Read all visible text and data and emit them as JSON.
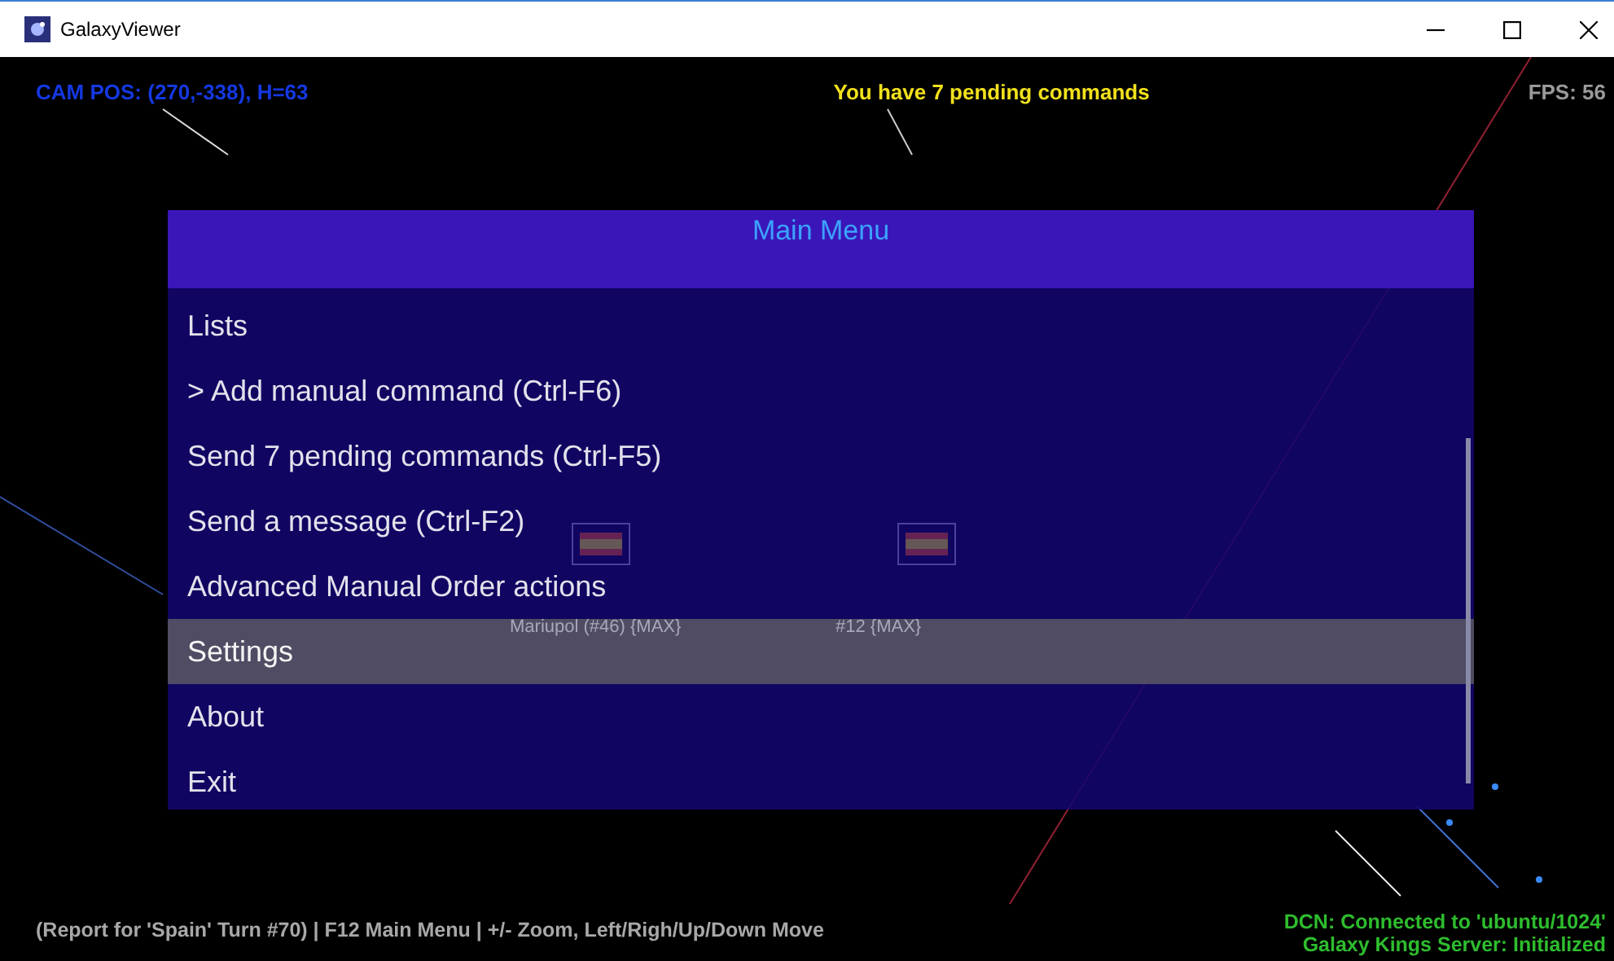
{
  "window": {
    "title": "GalaxyViewer"
  },
  "hud": {
    "camera": "CAM POS: (270,-338), H=63",
    "pending": "You have 7 pending commands",
    "fps": "FPS: 56"
  },
  "planets": [
    {
      "label": "Mariupol (#46) {MAX}"
    },
    {
      "label": "#12 {MAX}"
    }
  ],
  "menu": {
    "title": "Main Menu",
    "items": [
      {
        "label": "Lists",
        "selected": false
      },
      {
        "label": "> Add manual command (Ctrl-F6)",
        "selected": false
      },
      {
        "label": "Send 7 pending commands (Ctrl-F5)",
        "selected": false
      },
      {
        "label": "Send a message (Ctrl-F2)",
        "selected": false
      },
      {
        "label": "Advanced Manual Order actions",
        "selected": false
      },
      {
        "label": "Settings",
        "selected": true
      },
      {
        "label": "About",
        "selected": false
      },
      {
        "label": "Exit",
        "selected": false
      }
    ]
  },
  "status_bar": {
    "help": "(Report for 'Spain' Turn #70) | F12 Main Menu | +/- Zoom, Left/Righ/Up/Down Move",
    "connection": "DCN: Connected to 'ubuntu/1024'",
    "server": "Galaxy Kings Server: Initialized"
  }
}
